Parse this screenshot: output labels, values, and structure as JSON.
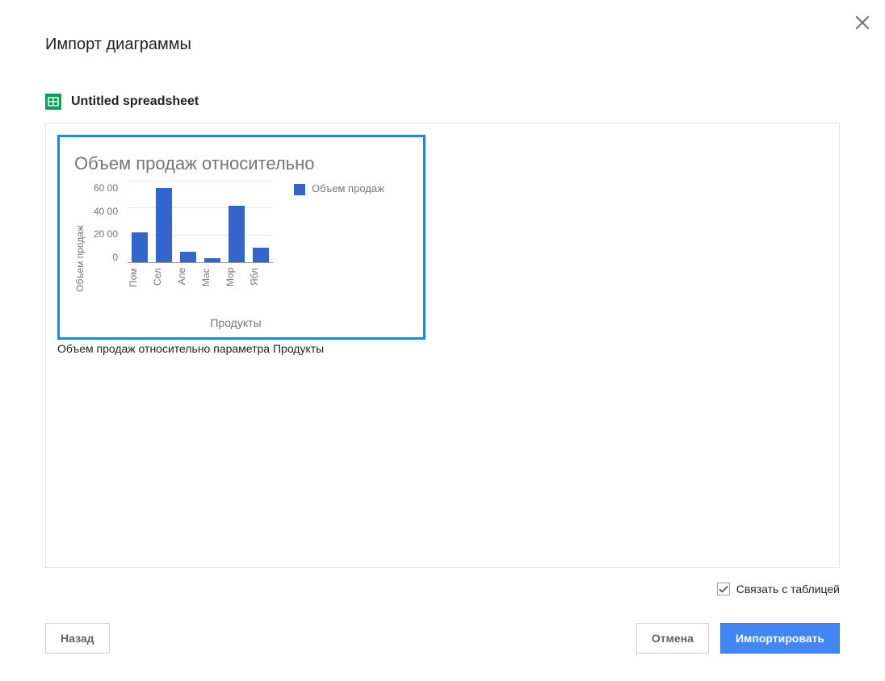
{
  "dialog": {
    "title": "Импорт диаграммы",
    "file_name": "Untitled spreadsheet"
  },
  "chart": {
    "caption": "Объем продаж относительно параметра Продукты",
    "title_visible": "Объем продаж относительно",
    "legend_label": "Объем продаж",
    "x_axis_label": "Продукты",
    "y_axis_label": "Объем продаж",
    "y_tick_0": "0",
    "y_tick_1": "20 00",
    "y_tick_2": "40 00",
    "y_tick_3": "60 00"
  },
  "chart_data": {
    "type": "bar",
    "title": "Объем продаж относительно параметра Продукты",
    "xlabel": "Продукты",
    "ylabel": "Объем продаж",
    "ylim": [
      0,
      6000
    ],
    "categories": [
      "Пом",
      "Сел",
      "Апе",
      "Мас",
      "Мор",
      "Ябл"
    ],
    "series": [
      {
        "name": "Объем продаж",
        "values": [
          2200,
          5500,
          800,
          300,
          4200,
          1100
        ]
      }
    ]
  },
  "footer": {
    "link_label": "Связать с таблицей",
    "link_checked": true,
    "back_label": "Назад",
    "cancel_label": "Отмена",
    "import_label": "Импортировать"
  },
  "colors": {
    "selection": "#0b8ee8",
    "bar": "#3366cc",
    "primary": "#4285f4"
  }
}
